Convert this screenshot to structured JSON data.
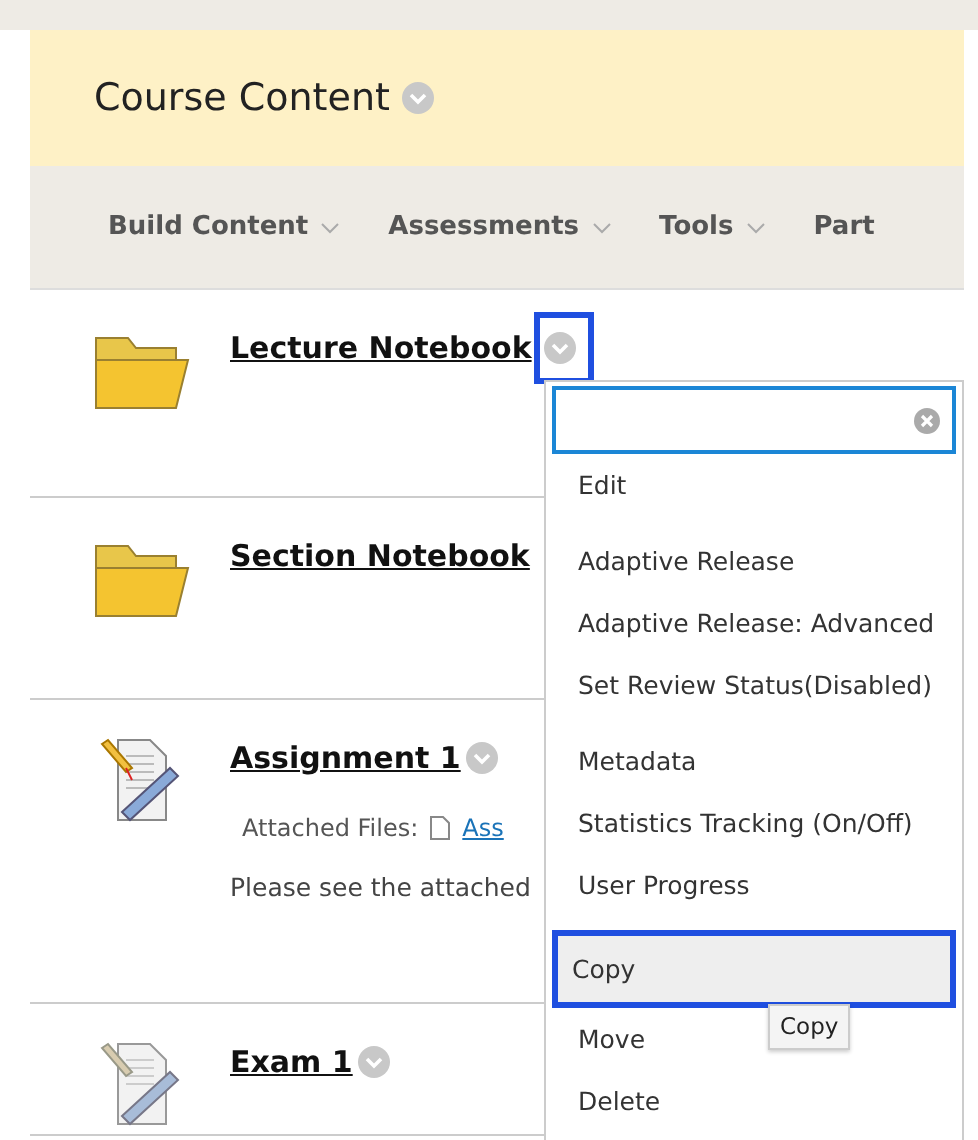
{
  "header": {
    "title": "Course Content"
  },
  "toolbar": [
    {
      "label": "Build Content",
      "caret": true
    },
    {
      "label": "Assessments",
      "caret": true
    },
    {
      "label": "Tools",
      "caret": true
    },
    {
      "label": "Part",
      "caret": false
    }
  ],
  "items": [
    {
      "kind": "folder",
      "title": "Lecture Notebook",
      "options_button": true,
      "focused": true
    },
    {
      "kind": "folder",
      "title": "Section Notebook",
      "options_button": false,
      "focused": false
    },
    {
      "kind": "assignment",
      "title": "Assignment 1",
      "options_button": true,
      "focused": false,
      "attached_label": "Attached Files:",
      "attached_file": "Ass",
      "description": "Please see the attached"
    },
    {
      "kind": "test",
      "title": "Exam 1",
      "options_button": true,
      "focused": false
    }
  ],
  "menu": {
    "groups": [
      [
        {
          "label": "Edit",
          "selected": false
        }
      ],
      [
        {
          "label": "Adaptive Release",
          "selected": false
        },
        {
          "label": "Adaptive Release: Advanced",
          "selected": false
        },
        {
          "label": "Set Review Status(Disabled)",
          "selected": false
        }
      ],
      [
        {
          "label": "Metadata",
          "selected": false
        },
        {
          "label": "Statistics Tracking (On/Off)",
          "selected": false
        },
        {
          "label": "User Progress",
          "selected": false
        }
      ],
      [
        {
          "label": "Copy",
          "selected": true
        },
        {
          "label": "Move",
          "selected": false
        },
        {
          "label": "Delete",
          "selected": false
        }
      ]
    ]
  },
  "tooltip": {
    "text": "Copy"
  }
}
